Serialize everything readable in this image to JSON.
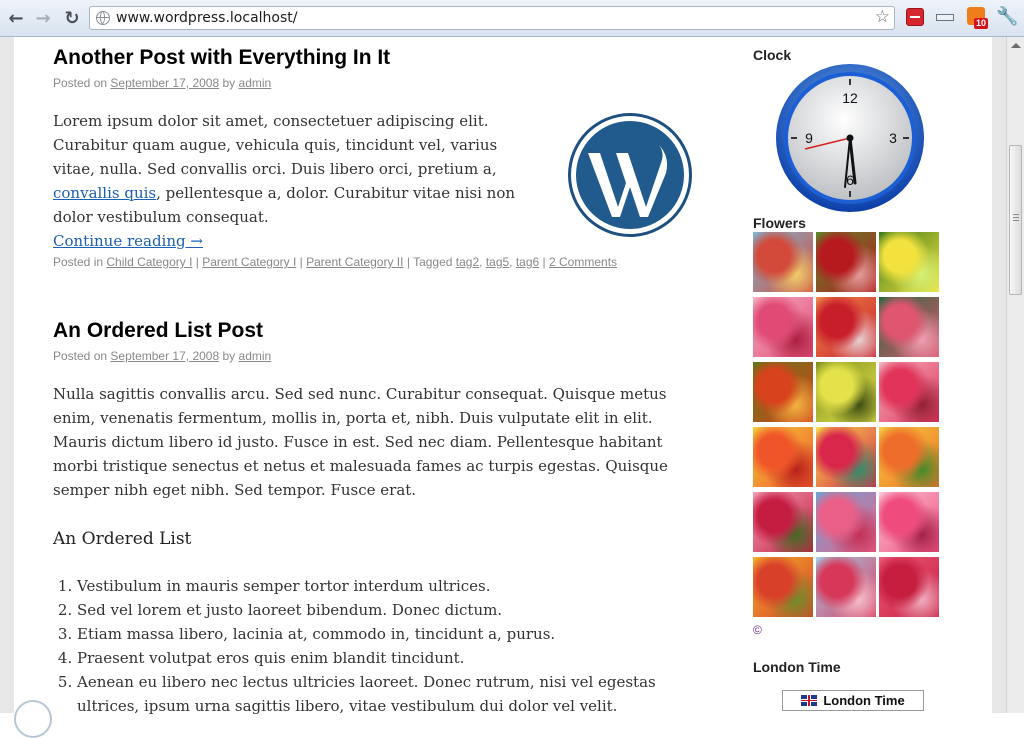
{
  "browser": {
    "url": "www.wordpress.localhost/",
    "extension_badge": "10"
  },
  "posts": [
    {
      "title": "Another Post with Everything In It",
      "meta": {
        "posted_on": "Posted on",
        "date": "September 17, 2008",
        "by": "by",
        "author": "admin"
      },
      "body": "Lorem ipsum dolor sit amet, consectetuer adipiscing elit. Curabitur quam augue, vehicula quis, tincidunt vel, varius vitae, nulla. Sed convallis orci. Duis libero orci, pretium a,",
      "link_text": "convallis quis",
      "body_after": ", pellentesque a, dolor. Curabitur vitae nisi non dolor vestibulum consequat.",
      "continue": "Continue reading →",
      "footer": {
        "posted_in": "Posted in",
        "categories": [
          "Child Category I",
          "Parent Category I",
          "Parent Category II"
        ],
        "tagged": "Tagged",
        "tags": [
          "tag2",
          "tag5",
          "tag6"
        ],
        "comments": "2 Comments"
      }
    },
    {
      "title": "An Ordered List Post",
      "meta": {
        "posted_on": "Posted on",
        "date": "September 17, 2008",
        "by": "by",
        "author": "admin"
      },
      "body": "Nulla sagittis convallis arcu. Sed sed nunc. Curabitur consequat. Quisque metus enim, venenatis fermentum, mollis in, porta et, nibh. Duis vulputate elit in elit. Mauris dictum libero id justo. Fusce in est. Sed nec diam. Pellentesque habitant morbi tristique senectus et netus et malesuada fames ac turpis egestas. Quisque semper nibh eget nibh. Sed tempor. Fusce erat.",
      "subheading": "An Ordered List",
      "list": [
        "Vestibulum in mauris semper tortor interdum ultrices.",
        "Sed vel lorem et justo laoreet bibendum. Donec dictum.",
        "Etiam massa libero, lacinia at, commodo in, tincidunt a, purus.",
        "Praesent volutpat eros quis enim blandit tincidunt.",
        "Aenean eu libero nec lectus ultricies laoreet. Donec rutrum, nisi vel egestas ultrices, ipsum urna sagittis libero, vitae vestibulum dui dolor vel velit."
      ]
    }
  ],
  "sidebar": {
    "clock_title": "Clock",
    "clock_numbers": {
      "n12": "12",
      "n3": "3",
      "n6": "6",
      "n9": "9"
    },
    "flowers_title": "Flowers",
    "copyright": "©",
    "london_title": "London Time",
    "london_button": "London Time",
    "flower_tiles": [
      [
        "#d34a3a",
        "#7bb9d8",
        "#f2d16a"
      ],
      [
        "#b61a1f",
        "#5a8a2a",
        "#e7a0a0"
      ],
      [
        "#f3e23d",
        "#3c7a1c",
        "#d2f27a"
      ],
      [
        "#e04a74",
        "#f7b0c4",
        "#a91d3f"
      ],
      [
        "#c81e2a",
        "#f08a4a",
        "#e9d4d8"
      ],
      [
        "#e0556f",
        "#1f6b3c",
        "#f2a2b5"
      ],
      [
        "#d8421c",
        "#5c7a18",
        "#f7b843"
      ],
      [
        "#e4e24a",
        "#7f8f1e",
        "#3a4a12"
      ],
      [
        "#e2335a",
        "#f1b5c0",
        "#8e1e33"
      ],
      [
        "#f0552a",
        "#f4d23a",
        "#b51d1a"
      ],
      [
        "#d9274b",
        "#f5e04a",
        "#2d8f6b"
      ],
      [
        "#ef6d2a",
        "#f6d13e",
        "#3e8a2b"
      ],
      [
        "#c51c42",
        "#f3a1b6",
        "#3d6b21"
      ],
      [
        "#e95f88",
        "#6aa8d8",
        "#c22d52"
      ],
      [
        "#f04b7d",
        "#f9c8d8",
        "#9e1f45"
      ],
      [
        "#d9402a",
        "#f3b12a",
        "#6b8f2a"
      ],
      [
        "#d7385a",
        "#a3d0ec",
        "#f7c0cd"
      ],
      [
        "#c71e40",
        "#ef5c7a",
        "#f2b2c4"
      ]
    ]
  }
}
